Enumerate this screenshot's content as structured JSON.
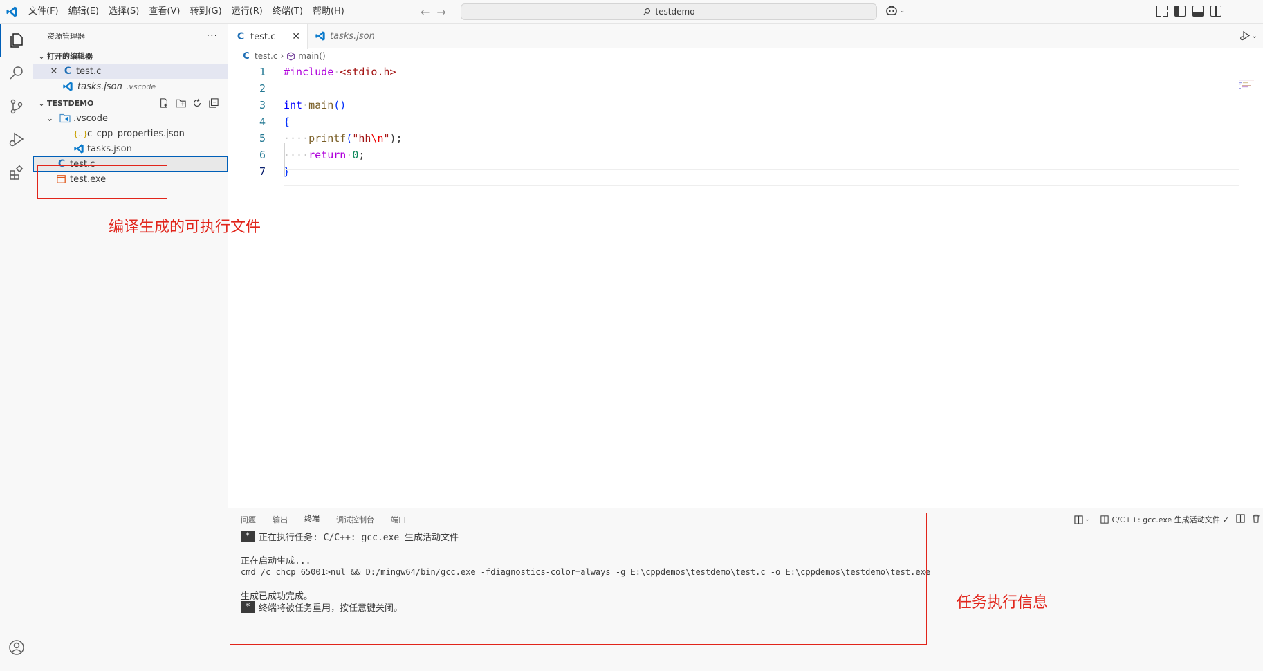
{
  "menu": [
    "文件(F)",
    "编辑(E)",
    "选择(S)",
    "查看(V)",
    "转到(G)",
    "运行(R)",
    "终端(T)",
    "帮助(H)"
  ],
  "command_center": {
    "text": "testdemo"
  },
  "sidebar": {
    "title": "资源管理器",
    "open_editors": {
      "label": "打开的编辑器",
      "items": [
        {
          "name": "test.c",
          "desc": ""
        },
        {
          "name": "tasks.json",
          "desc": ".vscode"
        }
      ]
    },
    "project": {
      "label": "TESTDEMO",
      "items": [
        {
          "name": ".vscode",
          "type": "folder"
        },
        {
          "name": "c_cpp_properties.json",
          "type": "json"
        },
        {
          "name": "tasks.json",
          "type": "vscode-json"
        },
        {
          "name": "test.c",
          "type": "c"
        },
        {
          "name": "test.exe",
          "type": "exe"
        }
      ]
    }
  },
  "editor": {
    "tabs": [
      {
        "label": "test.c",
        "active": true
      },
      {
        "label": "tasks.json",
        "active": false
      }
    ],
    "breadcrumb": [
      "test.c",
      "main()"
    ],
    "line_numbers": [
      "1",
      "2",
      "3",
      "4",
      "5",
      "6",
      "7"
    ],
    "code": {
      "l1_pre": "#include",
      "l1_inc": "<stdio.h>",
      "l3_kw": "int",
      "l3_fn": "main",
      "l3_paren": "()",
      "l4_brace": "{",
      "l5_fn": "printf",
      "l5_open": "(",
      "l5_str1": "\"hh",
      "l5_esc": "\\n",
      "l5_str2": "\"",
      "l5_close": ");",
      "l6_kw": "return",
      "l6_num": "0",
      "l6_semi": ";",
      "l7_brace": "}"
    }
  },
  "panel": {
    "tabs": [
      "问题",
      "输出",
      "终端",
      "调试控制台",
      "端口"
    ],
    "active_tab": "终端",
    "task_label": "C/C++: gcc.exe 生成活动文件",
    "terminal": {
      "badge": "*",
      "line1": "正在执行任务: C/C++: gcc.exe 生成活动文件",
      "line2": "正在启动生成...",
      "line3": "cmd /c chcp 65001>nul && D:/mingw64/bin/gcc.exe -fdiagnostics-color=always -g E:\\cppdemos\\testdemo\\test.c -o E:\\cppdemos\\testdemo\\test.exe",
      "line4": "生成已成功完成。",
      "line5": "终端将被任务重用，按任意键关闭。"
    }
  },
  "annotations": {
    "exe_label": "编译生成的可执行文件",
    "task_label": "任务执行信息"
  },
  "colors": {
    "accent": "#005fb8",
    "annotation": "#e1251b"
  }
}
